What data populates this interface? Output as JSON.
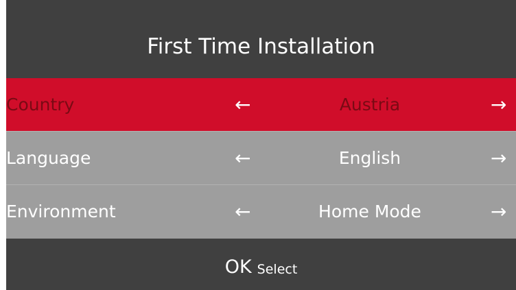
{
  "header": {
    "title": "First Time Installation"
  },
  "settings": [
    {
      "label": "Country",
      "value": "Austria",
      "left_arrow": "←",
      "right_arrow": "→",
      "selected": true
    },
    {
      "label": "Language",
      "value": "English",
      "left_arrow": "←",
      "right_arrow": "→",
      "selected": false
    },
    {
      "label": "Environment",
      "value": "Home Mode",
      "left_arrow": "←",
      "right_arrow": "→",
      "selected": false
    }
  ],
  "footer": {
    "key": "OK",
    "action": "Select"
  },
  "colors": {
    "background": "#404040",
    "selected_row": "#d00d2a",
    "selected_text": "#7a0a14",
    "row": "#9e9e9e",
    "text": "#ffffff"
  }
}
